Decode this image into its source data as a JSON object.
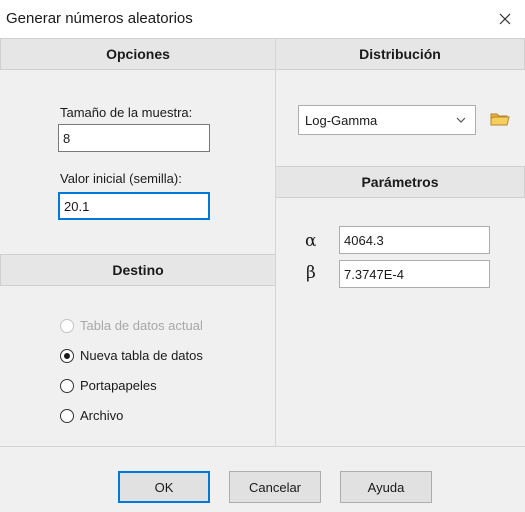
{
  "window": {
    "title": "Generar números aleatorios"
  },
  "options": {
    "header": "Opciones",
    "sample_size_label": "Tamaño de la muestra:",
    "sample_size_value": "8",
    "seed_label": "Valor inicial (semilla):",
    "seed_value": "20.1"
  },
  "destination": {
    "header": "Destino",
    "radios": [
      {
        "label": "Tabla de datos actual",
        "checked": false,
        "disabled": true
      },
      {
        "label": "Nueva tabla de datos",
        "checked": true,
        "disabled": false
      },
      {
        "label": "Portapapeles",
        "checked": false,
        "disabled": false
      },
      {
        "label": "Archivo",
        "checked": false,
        "disabled": false
      }
    ]
  },
  "distribution": {
    "header": "Distribución",
    "selected": "Log-Gamma"
  },
  "parameters": {
    "header": "Parámetros",
    "alpha_symbol": "α",
    "alpha_value": "4064.3",
    "beta_symbol": "β",
    "beta_value": "7.3747E-4"
  },
  "buttons": {
    "ok": "OK",
    "cancel": "Cancelar",
    "help": "Ayuda"
  },
  "icons": {
    "close": "close-icon",
    "dropdown": "chevron-down-icon",
    "folder": "folder-icon"
  },
  "colors": {
    "focus_accent": "#0078d7",
    "header_background": "#e6e6e6",
    "dialog_background": "#f0f0f0"
  }
}
